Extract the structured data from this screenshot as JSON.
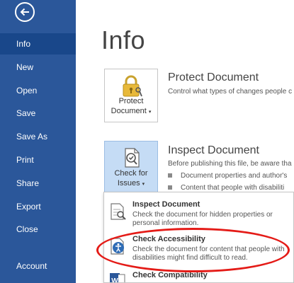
{
  "sidebar": {
    "items": [
      {
        "label": "Info",
        "active": true
      },
      {
        "label": "New"
      },
      {
        "label": "Open"
      },
      {
        "label": "Save"
      },
      {
        "label": "Save As"
      },
      {
        "label": "Print"
      },
      {
        "label": "Share"
      },
      {
        "label": "Export"
      },
      {
        "label": "Close"
      },
      {
        "label": "Account"
      }
    ]
  },
  "main": {
    "title": "Info",
    "protect": {
      "button_label_line1": "Protect",
      "button_label_line2": "Document",
      "heading": "Protect Document",
      "description": "Control what types of changes people c"
    },
    "inspect": {
      "button_label_line1": "Check for",
      "button_label_line2": "Issues",
      "heading": "Inspect Document",
      "description": "Before publishing this file, be aware tha",
      "bullets": [
        "Document properties and author's",
        "Content that people with disabiliti"
      ]
    }
  },
  "dropdown": {
    "items": [
      {
        "title": "Inspect Document",
        "description": "Check the document for hidden properties or personal information."
      },
      {
        "title": "Check Accessibility",
        "description": "Check the document for content that people with disabilities might find difficult to read."
      },
      {
        "title": "Check Compatibility",
        "description": ""
      }
    ]
  },
  "colors": {
    "sidebar": "#2b579a",
    "sidebar_active": "#19478a",
    "highlight": "#e41b17"
  }
}
